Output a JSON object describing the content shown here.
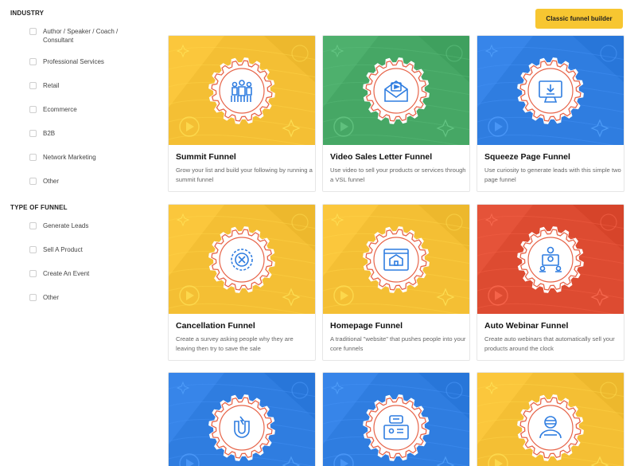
{
  "sidebar": {
    "industry_title": "INDUSTRY",
    "industry": [
      {
        "label": "Author / Speaker / Coach / Consultant"
      },
      {
        "label": "Professional Services"
      },
      {
        "label": "Retail"
      },
      {
        "label": "Ecommerce"
      },
      {
        "label": "B2B"
      },
      {
        "label": "Network Marketing"
      },
      {
        "label": "Other"
      }
    ],
    "type_title": "TYPE OF FUNNEL",
    "type": [
      {
        "label": "Generate Leads"
      },
      {
        "label": "Sell A Product"
      },
      {
        "label": "Create An Event"
      },
      {
        "label": "Other"
      }
    ]
  },
  "toolbar": {
    "classic_label": "Classic funnel builder",
    "accent": "#f7c631"
  },
  "cards": [
    {
      "title": "Summit Funnel",
      "desc": "Grow your list and build your following by running a summit funnel",
      "color": "#f4bf34",
      "icon": "people-icon"
    },
    {
      "title": "Video Sales Letter Funnel",
      "desc": "Use video to sell your products or services through a VSL funnel",
      "color": "#46a765",
      "icon": "video-envelope-icon"
    },
    {
      "title": "Squeeze Page Funnel",
      "desc": "Use curiosity to generate leads with this simple two page funnel",
      "color": "#2f7de0",
      "icon": "monitor-download-icon"
    },
    {
      "title": "Cancellation Funnel",
      "desc": "Create a survey asking people why they are leaving then try to save the sale",
      "color": "#f4bf34",
      "icon": "cancel-icon"
    },
    {
      "title": "Homepage Funnel",
      "desc": "A traditional \"website\" that pushes people into your core funnels",
      "color": "#f4bf34",
      "icon": "house-window-icon"
    },
    {
      "title": "Auto Webinar Funnel",
      "desc": "Create auto webinars that automatically sell your products around the clock",
      "color": "#dd4b31",
      "icon": "webinar-presenter-icon"
    },
    {
      "title": "",
      "desc": "",
      "color": "#2f7de0",
      "icon": "magnet-icon"
    },
    {
      "title": "",
      "desc": "",
      "color": "#2f7de0",
      "icon": "chat-monitor-icon"
    },
    {
      "title": "",
      "desc": "",
      "color": "#f4bf34",
      "icon": "person-pattern-icon"
    }
  ]
}
